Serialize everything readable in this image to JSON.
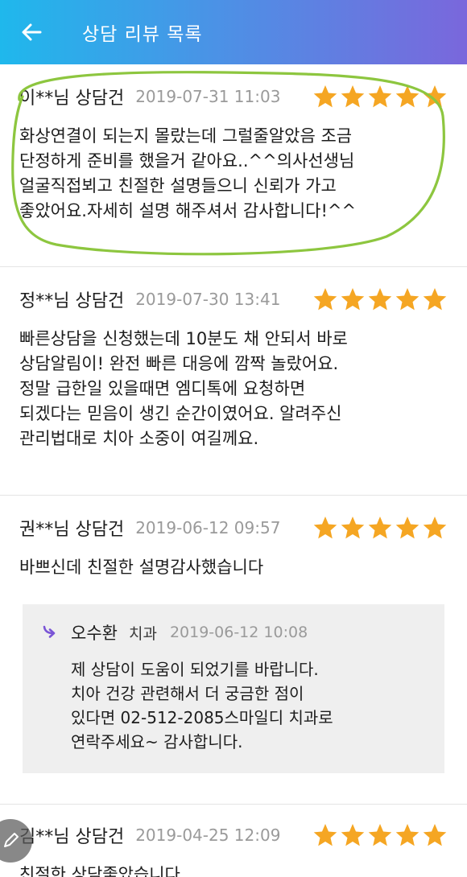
{
  "header": {
    "title": "상담 리뷰 목록",
    "back_icon": "arrow-left-icon"
  },
  "colors": {
    "header_gradient_start": "#1fb8ec",
    "header_gradient_end": "#7a67dc",
    "star": "#f5a623",
    "highlight": "#8dc63f",
    "reply_bg": "#efefef",
    "reply_arrow": "#7a55d6"
  },
  "reviews": [
    {
      "reviewer": "이**님 상담건",
      "date": "2019-07-31 11:03",
      "rating": 5,
      "body": "화상연결이 되는지 몰랐는데 그럴줄알았음 조금\n단정하게 준비를 했을거 같아요..^^의사선생님\n얼굴직접뵈고 친절한 설명들으니 신뢰가 가고\n좋았어요.자세히 설명 해주셔서 감사합니다!^^"
    },
    {
      "reviewer": "정**님 상담건",
      "date": "2019-07-30 13:41",
      "rating": 5,
      "body": "빠른상담을 신청했는데 10분도 채 안되서 바로\n상담알림이! 완전 빠른 대응에 깜짝 놀랐어요.\n정말 급한일 있을때면 엠디톡에 요청하면\n되겠다는 믿음이 생긴 순간이였어요. 알려주신\n관리법대로 치아 소중이 여길께요."
    },
    {
      "reviewer": "권**님 상담건",
      "date": "2019-06-12 09:57",
      "rating": 5,
      "body": "바쁘신데 친절한 설명감사했습니다",
      "reply": {
        "author": "오수환",
        "dept": "치과",
        "date": "2019-06-12 10:08",
        "body": "제 상담이 도움이 되었기를 바랍니다.\n치아 건강 관련해서 더 궁금한 점이\n있다면 02-512-2085스마일디 치과로\n연락주세요~ 감사합니다."
      }
    },
    {
      "reviewer": "김**님 상담건",
      "date": "2019-04-25 12:09",
      "rating": 5,
      "body": "친절한 상담좋았습니다"
    }
  ]
}
